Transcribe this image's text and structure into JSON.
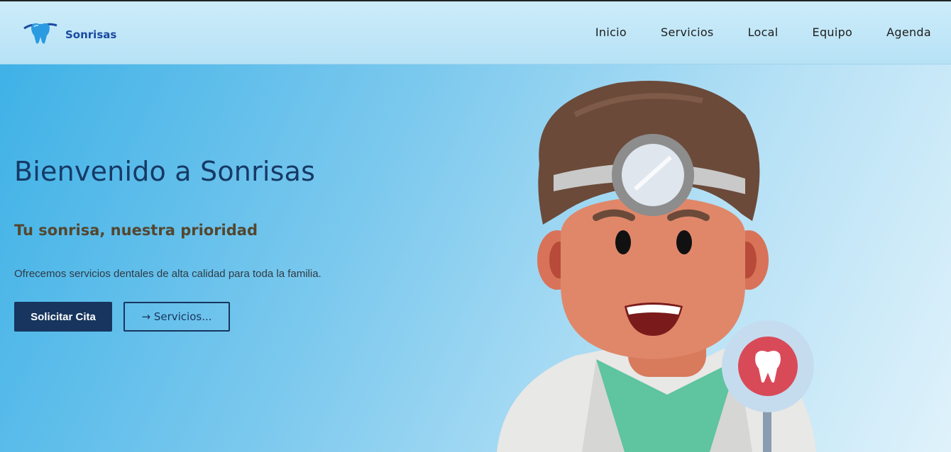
{
  "header": {
    "brand_name": "Sonrisas",
    "logo_icon": "tooth-logo-icon",
    "nav": [
      "Inicio",
      "Servicios",
      "Local",
      "Equipo",
      "Agenda"
    ]
  },
  "hero": {
    "title": "Bienvenido a Sonrisas",
    "subtitle": "Tu sonrisa, nuestra prioridad",
    "text": "Ofrecemos servicios dentales de alta calidad para toda la familia.",
    "primary_button": "Solicitar Cita",
    "secondary_button": "→ Servicios..."
  },
  "colors": {
    "brand": "#1a4aa0",
    "primary_button": "#17355e",
    "background_start": "#3bb0e6",
    "background_end": "#dff2fb"
  }
}
